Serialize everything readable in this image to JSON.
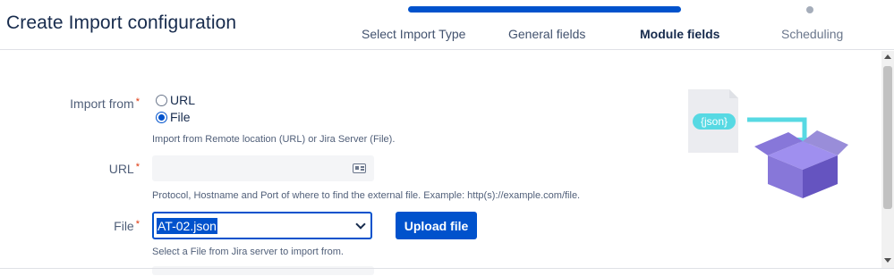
{
  "header": {
    "title": "Create Import configuration",
    "steps": [
      {
        "label": "Select Import Type",
        "state": "done"
      },
      {
        "label": "General fields",
        "state": "done"
      },
      {
        "label": "Module fields",
        "state": "active"
      },
      {
        "label": "Scheduling",
        "state": "future"
      }
    ],
    "progress_fraction": 0.75
  },
  "form": {
    "import_from": {
      "label": "Import from",
      "required_mark": "*",
      "options": [
        "URL",
        "File"
      ],
      "selected": "File",
      "help": "Import from Remote location (URL) or Jira Server (File)."
    },
    "url": {
      "label": "URL",
      "required_mark": "*",
      "value": "",
      "icon": "id-card-icon",
      "help": "Protocol, Hostname and Port of where to find the external file. Example: http(s)://example.com/file."
    },
    "file": {
      "label": "File",
      "required_mark": "*",
      "selected": "AT-02.json",
      "upload_label": "Upload file",
      "help": "Select a File from Jira server to import from."
    }
  },
  "illustration": {
    "badge_text": "{json}"
  },
  "colors": {
    "primary": "#0052cc",
    "required": "#de350b",
    "box": "#8b6fd6",
    "arrow": "#57d9e3"
  }
}
